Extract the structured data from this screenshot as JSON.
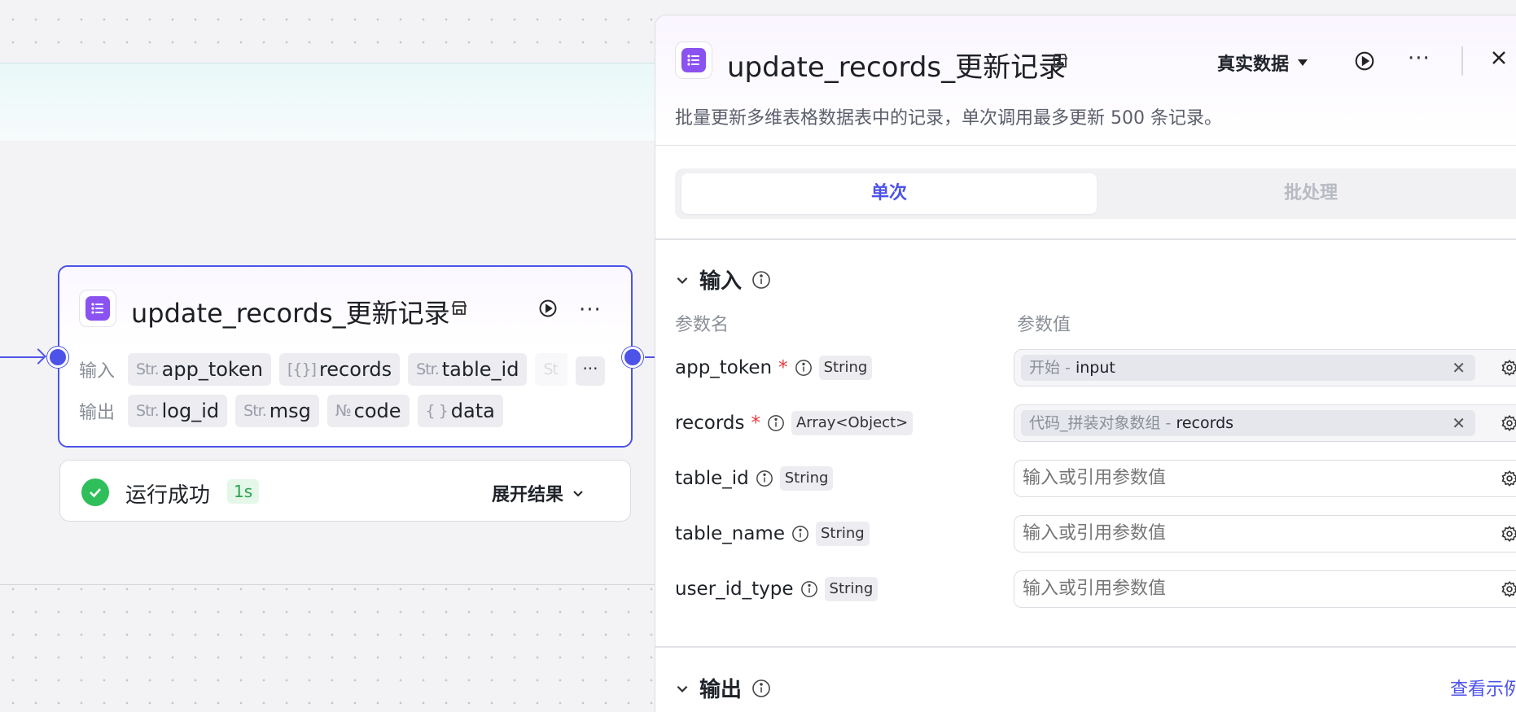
{
  "node": {
    "title": "update_records_更新记录",
    "input_label": "输入",
    "output_label": "输出",
    "inputs": [
      {
        "type": "Str.",
        "name": "app_token"
      },
      {
        "type": "[{}]",
        "name": "records"
      },
      {
        "type": "Str.",
        "name": "table_id"
      },
      {
        "type": "St",
        "name": ""
      }
    ],
    "outputs": [
      {
        "type": "Str.",
        "name": "log_id"
      },
      {
        "type": "Str.",
        "name": "msg"
      },
      {
        "type": "№",
        "name": "code"
      },
      {
        "type": "{ }",
        "name": "data"
      }
    ],
    "more": "···"
  },
  "result": {
    "status": "运行成功",
    "duration": "1s",
    "expand": "展开结果"
  },
  "panel": {
    "title": "update_records_更新记录",
    "data_mode": "真实数据",
    "more": "···",
    "description": "批量更新多维表格数据表中的记录，单次调用最多更新 500 条记录。",
    "tabs": [
      "单次",
      "批处理"
    ],
    "input_section": "输入",
    "col_name": "参数名",
    "col_value": "参数值",
    "params": [
      {
        "name": "app_token",
        "required": true,
        "type": "String",
        "value_source": "开始 - ",
        "value": "input"
      },
      {
        "name": "records",
        "required": true,
        "type": "Array<Object>",
        "value_source": "代码_拼装对象数组 - ",
        "value": "records"
      },
      {
        "name": "table_id",
        "required": false,
        "type": "String",
        "placeholder": "输入或引用参数值"
      },
      {
        "name": "table_name",
        "required": false,
        "type": "String",
        "placeholder": "输入或引用参数值"
      },
      {
        "name": "user_id_type",
        "required": false,
        "type": "String",
        "placeholder": "输入或引用参数值"
      }
    ],
    "output_section": "输出",
    "view_example": "查看示例"
  },
  "colors": {
    "accent": "#4d53e8",
    "success": "#2fbf5a",
    "icon_bg": "#8a52f0",
    "required": "#e5383b"
  }
}
